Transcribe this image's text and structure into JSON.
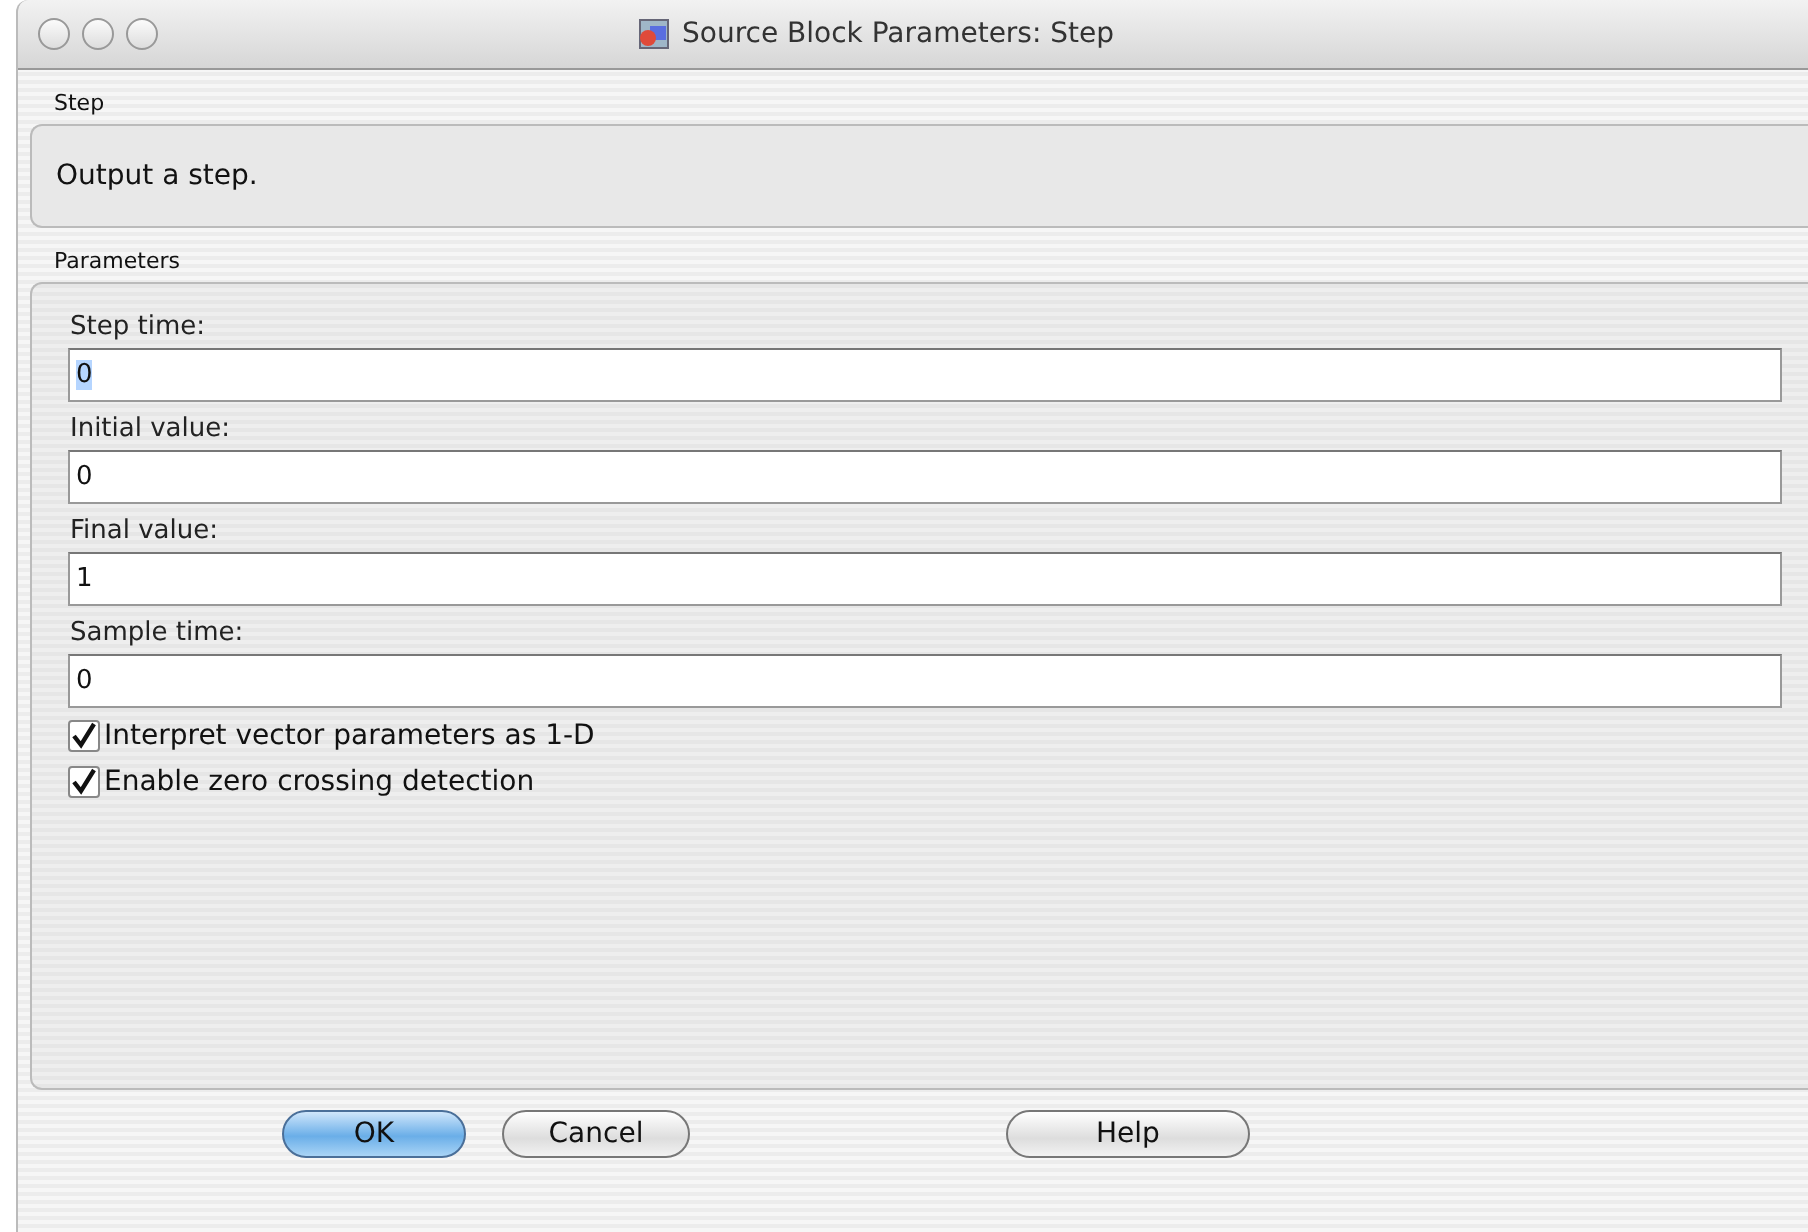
{
  "window": {
    "title": "Source Block Parameters: Step"
  },
  "description": {
    "heading": "Step",
    "text": "Output a step."
  },
  "parameters": {
    "heading": "Parameters",
    "fields": [
      {
        "label": "Step time:",
        "value": "0",
        "text_selected": true
      },
      {
        "label": "Initial value:",
        "value": "0",
        "text_selected": false
      },
      {
        "label": "Final value:",
        "value": "1",
        "text_selected": false
      },
      {
        "label": "Sample time:",
        "value": "0",
        "text_selected": false
      }
    ],
    "checkboxes": [
      {
        "label": "Interpret vector parameters as 1-D",
        "checked": true
      },
      {
        "label": "Enable zero crossing detection",
        "checked": true
      }
    ]
  },
  "buttons": [
    {
      "label": "OK",
      "kind": "default"
    },
    {
      "label": "Cancel",
      "kind": "normal"
    },
    {
      "label": "Help",
      "kind": "normal"
    }
  ]
}
